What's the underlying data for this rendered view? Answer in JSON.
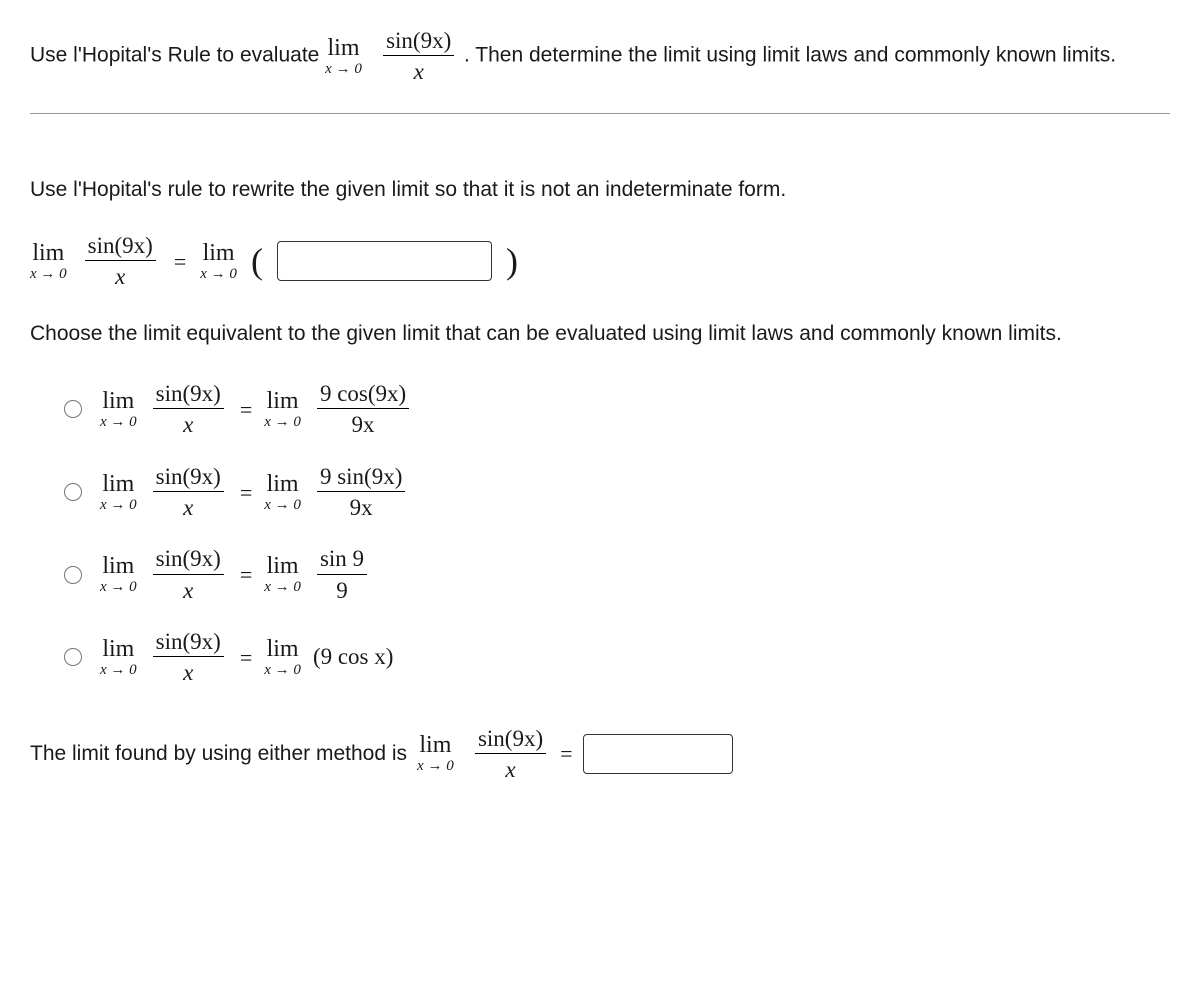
{
  "header": {
    "text_before": "Use l'Hopital's Rule to evaluate ",
    "lim_word": "lim",
    "lim_sub": "x → 0",
    "frac_num": "sin(9x)",
    "frac_den": "x",
    "text_after": ". Then determine the limit using limit laws and commonly known limits."
  },
  "section1": {
    "instruction": "Use l'Hopital's rule to rewrite the given limit so that it is not an indeterminate form.",
    "lhs_lim": "lim",
    "lhs_sub": "x → 0",
    "lhs_num": "sin(9x)",
    "lhs_den": "x",
    "equals": "=",
    "rhs_lim": "lim",
    "rhs_sub": "x → 0",
    "lparen": "(",
    "rparen": ")",
    "input_value": ""
  },
  "section2": {
    "instruction": "Choose the limit equivalent to the given limit that can be evaluated using limit laws and commonly known limits.",
    "choices": [
      {
        "l_lim": "lim",
        "l_sub": "x → 0",
        "l_num": "sin(9x)",
        "l_den": "x",
        "eq": "=",
        "r_lim": "lim",
        "r_sub": "x → 0",
        "r_num": "9 cos(9x)",
        "r_den": "9x"
      },
      {
        "l_lim": "lim",
        "l_sub": "x → 0",
        "l_num": "sin(9x)",
        "l_den": "x",
        "eq": "=",
        "r_lim": "lim",
        "r_sub": "x → 0",
        "r_num": "9 sin(9x)",
        "r_den": "9x"
      },
      {
        "l_lim": "lim",
        "l_sub": "x → 0",
        "l_num": "sin(9x)",
        "l_den": "x",
        "eq": "=",
        "r_lim": "lim",
        "r_sub": "x → 0",
        "r_num": "sin 9",
        "r_den": "9"
      },
      {
        "l_lim": "lim",
        "l_sub": "x → 0",
        "l_num": "sin(9x)",
        "l_den": "x",
        "eq": "=",
        "r_lim": "lim",
        "r_sub": "x → 0",
        "r_plain": "(9 cos x)"
      }
    ]
  },
  "final": {
    "text": "The limit found by using either method is ",
    "lim": "lim",
    "sub": "x → 0",
    "num": "sin(9x)",
    "den": "x",
    "equals": "=",
    "input_value": ""
  }
}
